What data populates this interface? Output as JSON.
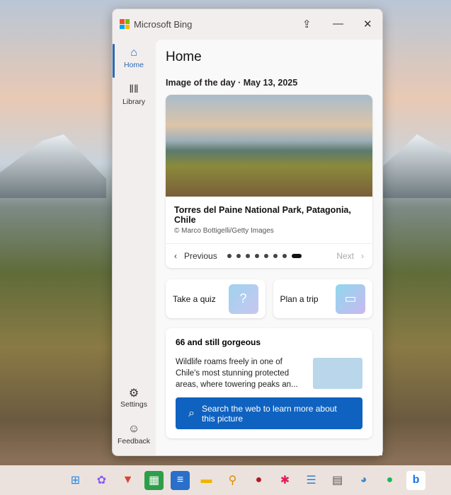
{
  "window": {
    "title": "Microsoft Bing"
  },
  "nav": {
    "home": "Home",
    "library": "Library",
    "settings": "Settings",
    "feedback": "Feedback"
  },
  "main": {
    "title": "Home",
    "iotd_heading": "Image of the day · May 13, 2025",
    "image": {
      "title": "Torres del Paine National Park, Patagonia, Chile",
      "credit": "© Marco Bottigelli/Getty Images"
    },
    "pager": {
      "previous": "Previous",
      "next": "Next",
      "total": 8,
      "current": 8
    },
    "quiz": "Take a quiz",
    "trip": "Plan a trip",
    "article": {
      "title": "66 and still gorgeous",
      "body": "Wildlife roams freely in one of Chile's most stunning protected areas, where towering peaks an...",
      "button": "Search the web to learn more about this picture"
    }
  },
  "taskbar": [
    "windows-start",
    "copilot",
    "brave",
    "libreoffice-calc",
    "libreoffice-writer",
    "file-explorer",
    "search-tool",
    "cherry",
    "slack",
    "notepad",
    "calculator",
    "paint",
    "spotify",
    "bing"
  ]
}
